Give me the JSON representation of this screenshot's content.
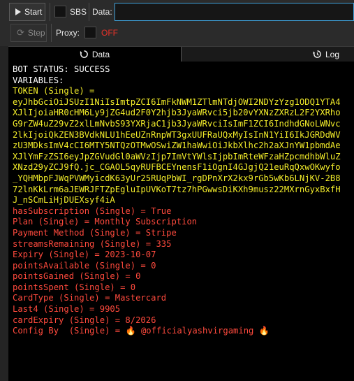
{
  "toolbar": {
    "start_label": "Start",
    "sbs_label": "SBS",
    "data_label": "Data:",
    "data_value": "",
    "step_label": "Step",
    "proxy_label": "Proxy:",
    "proxy_state": "OFF",
    "proxy_state_color": "#e8322a"
  },
  "tabs": [
    {
      "label": "Data",
      "icon": "circle-arrow-icon",
      "active": true
    },
    {
      "label": "Log",
      "icon": "history-icon",
      "active": false
    }
  ],
  "console": {
    "colors": {
      "white": "#ffffff",
      "yellow": "#f2ec2a",
      "red": "#ff4a3d"
    },
    "lines": [
      {
        "text": "BOT STATUS: SUCCESS",
        "color": "white"
      },
      {
        "text": "VARIABLES:",
        "color": "white"
      },
      {
        "text": "TOKEN (Single) =",
        "color": "yellow"
      },
      {
        "text": "eyJhbGciOiJSUzI1NiIsImtpZCI6ImFkNWM1ZTlmNTdjOWI2NDYzYzg1ODQ1YTA4",
        "color": "yellow"
      },
      {
        "text": "XJlIjoiaHR0cHM6Ly9jZG4ud2F0Y2hjb3JyaWRvci5jb20vYXNzZXRzL2F2YXRho",
        "color": "yellow"
      },
      {
        "text": "G9rZW4uZ29vZ2xlLmNvbS93YXRjaC1jb3JyaWRvciIsImF1ZCI6IndhdGNoLWNvc",
        "color": "yellow"
      },
      {
        "text": "2lkIjoiQkZEN3BVdkNLU1hEeUZnRnpWT3gxUUFRaUQxMyIsInN1YiI6IkJGRDdWV",
        "color": "yellow"
      },
      {
        "text": "zU3MDksImV4cCI6MTY5NTQzOTMwOSwiZW1haWwiOiJkbXlhc2h2aXJnYW1pbmdAe",
        "color": "yellow"
      },
      {
        "text": "XJlYmFzZSI6eyJpZGVudGl0aWVzIjp7ImVtYWlsIjpbImRteWFzaHZpcmdhbWluZ",
        "color": "yellow"
      },
      {
        "text": "XNzd29yZCJ9fQ.jc_CGAOL5qyRUFBCEYnensF1iOgnI4GJgjQ21euRqQxwOKwyfo",
        "color": "yellow"
      },
      {
        "text": "_YQHMbpFJWqPVWMyicdK63yUr25RUqPbWI_rgDPnXrX2kx9rGb5wKb6LNjKV-2B8",
        "color": "yellow"
      },
      {
        "text": "72lnKkLrm6aJEWRJFTZpEgluIpUVKoT7tz7hPGwwsDiKXh9musz22MXrnGyxBxfH",
        "color": "yellow"
      },
      {
        "text": "J_nSCmLiHjDUEXsyf4iA",
        "color": "yellow"
      },
      {
        "text": "hasSubscription (Single) = True",
        "color": "red"
      },
      {
        "text": "Plan (Single) = Monthly Subscription",
        "color": "red"
      },
      {
        "text": "Payment Method (Single) = Stripe",
        "color": "red"
      },
      {
        "text": "streamsRemaining (Single) = 335",
        "color": "red"
      },
      {
        "text": "Expiry (Single) = 2023-10-07",
        "color": "red"
      },
      {
        "text": "pointsAvailable (Single) = 0",
        "color": "red"
      },
      {
        "text": "pointsGained (Single) = 0",
        "color": "red"
      },
      {
        "text": "pointsSpent (Single) = 0",
        "color": "red"
      },
      {
        "text": "CardType (Single) = Mastercard",
        "color": "red"
      },
      {
        "text": "Last4 (Single) = 9905",
        "color": "red"
      },
      {
        "text": "cardExpiry (Single) = 8/2026",
        "color": "red"
      }
    ],
    "config_line": {
      "prefix": "Config By  (Single) = ",
      "author": "@officialyashvirgaming",
      "emoji": "🔥",
      "color": "red"
    }
  }
}
